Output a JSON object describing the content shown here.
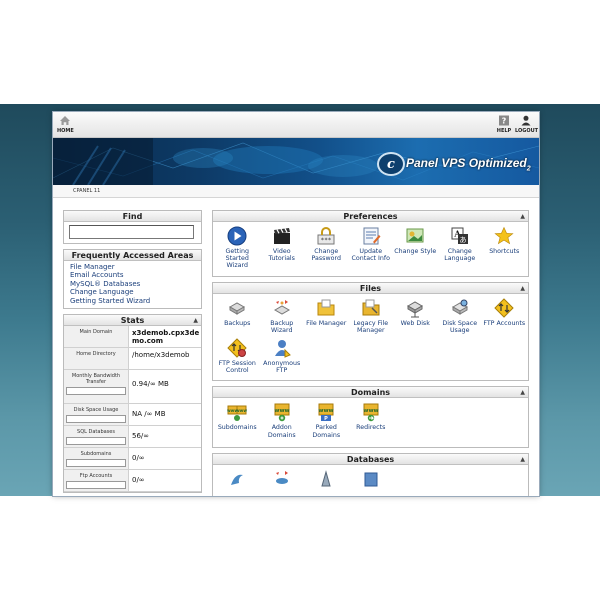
{
  "topbar": {
    "home_label": "HOME",
    "help_label": "HELP",
    "logout_label": "LOGOUT"
  },
  "banner": {
    "logo_letter": "c",
    "logo_text": "Panel VPS Optimized",
    "logo_suffix": "2"
  },
  "breadcrumb": "CPANEL 11",
  "find": {
    "title": "Find",
    "value": ""
  },
  "frequent": {
    "title": "Frequently Accessed Areas",
    "links": [
      "File Manager",
      "Email Accounts",
      "MySQL® Databases",
      "Change Language",
      "Getting Started Wizard"
    ]
  },
  "stats": {
    "title": "Stats",
    "rows": [
      {
        "label": "Main Domain",
        "value": "x3demob.cpx3demo.com",
        "bar": false
      },
      {
        "label": "Home Directory",
        "value": "/home/x3demob",
        "bar": false
      },
      {
        "label": "Monthly Bandwidth Transfer",
        "value": "0.94/∞ MB",
        "bar": true
      },
      {
        "label": "Disk Space Usage",
        "value": "NA /∞ MB",
        "bar": true
      },
      {
        "label": "SQL Databases",
        "value": "56/∞",
        "bar": true
      },
      {
        "label": "Subdomains",
        "value": "0/∞",
        "bar": true
      },
      {
        "label": "Ftp Accounts",
        "value": "0/∞",
        "bar": true
      }
    ]
  },
  "preferences": {
    "title": "Preferences",
    "items": [
      {
        "label": "Getting Started Wizard",
        "icon": "play-icon"
      },
      {
        "label": "Video Tutorials",
        "icon": "clapper-icon"
      },
      {
        "label": "Change Password",
        "icon": "password-icon"
      },
      {
        "label": "Update Contact Info",
        "icon": "contact-icon"
      },
      {
        "label": "Change Style",
        "icon": "style-icon"
      },
      {
        "label": "Change Language",
        "icon": "language-icon"
      },
      {
        "label": "Shortcuts",
        "icon": "star-icon"
      }
    ]
  },
  "files": {
    "title": "Files",
    "items": [
      {
        "label": "Backups",
        "icon": "backup-icon"
      },
      {
        "label": "Backup Wizard",
        "icon": "backup-wizard-icon"
      },
      {
        "label": "File Manager",
        "icon": "folder-icon"
      },
      {
        "label": "Legacy File Manager",
        "icon": "legacy-folder-icon"
      },
      {
        "label": "Web Disk",
        "icon": "webdisk-icon"
      },
      {
        "label": "Disk Space Usage",
        "icon": "disk-icon"
      },
      {
        "label": "FTP Accounts",
        "icon": "ftp-icon"
      },
      {
        "label": "FTP Session Control",
        "icon": "ftp-session-icon"
      },
      {
        "label": "Anonymous FTP",
        "icon": "anon-ftp-icon"
      }
    ]
  },
  "domains": {
    "title": "Domains",
    "items": [
      {
        "label": "Subdomains",
        "icon": "subdomains-icon"
      },
      {
        "label": "Addon Domains",
        "icon": "addon-domains-icon"
      },
      {
        "label": "Parked Domains",
        "icon": "parked-domains-icon"
      },
      {
        "label": "Redirects",
        "icon": "redirects-icon"
      }
    ]
  },
  "databases": {
    "title": "Databases"
  },
  "colors": {
    "link": "#1a3e7a",
    "banner": "#0d3a66",
    "background": "#2b5f73"
  }
}
